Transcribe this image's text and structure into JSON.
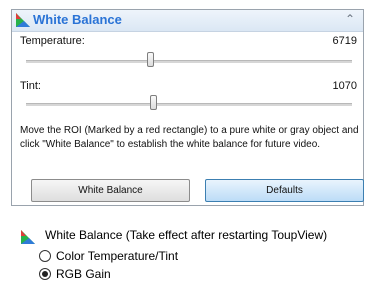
{
  "panel": {
    "title": "White Balance",
    "collapse_glyph": "⌃",
    "temperature": {
      "label": "Temperature:",
      "value": "6719",
      "fraction": 0.38
    },
    "tint": {
      "label": "Tint:",
      "value": "1070",
      "fraction": 0.39
    },
    "note": "Move the ROI (Marked by a red rectangle) to a pure white or gray object and click \"White Balance\" to establish the white balance for future video.",
    "buttons": {
      "white_balance": "White Balance",
      "defaults": "Defaults"
    }
  },
  "options": {
    "title": "White Balance (Take effect after restarting ToupView)",
    "radios": [
      {
        "label": "Color Temperature/Tint",
        "selected": false
      },
      {
        "label": "RGB Gain",
        "selected": true
      }
    ]
  },
  "icons": {
    "panel_icon": "white-balance-icon",
    "options_icon": "white-balance-icon"
  },
  "colors": {
    "title_blue": "#2a73d6",
    "accent_blue": "#3c7fb1"
  }
}
